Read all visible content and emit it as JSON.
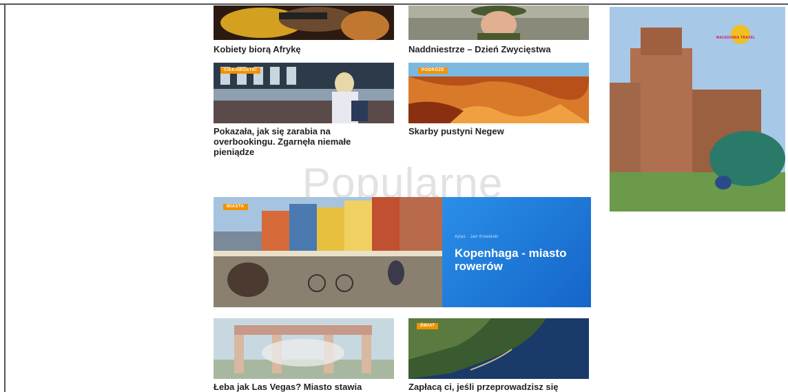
{
  "articles": [
    {
      "title": "Kobiety biorą Afrykę",
      "tag": ""
    },
    {
      "title": "Naddniestrze – Dzień Zwycięstwa",
      "tag": ""
    },
    {
      "title": "Pokazała, jak się zarabia na overbookingu. Zgarnęła niemałe pieniądze",
      "tag": "CIEKAWOSTKI"
    },
    {
      "title": "Skarby pustyni Negew",
      "tag": "PODRÓŻE"
    },
    {
      "title": "Łeba jak Las Vegas? Miasto stawia",
      "tag": ""
    },
    {
      "title": "Zapłacą ci, jeśli przeprowadzisz się",
      "tag": "ŚWIAT"
    }
  ],
  "section": {
    "heading": "Popularne"
  },
  "featured": {
    "tag": "MIASTA",
    "meta": "Ajtaś · Jan Kowalski",
    "title": "Kopenhaga - miasto rowerów"
  },
  "ad": {
    "logo_text": "MACEDONIA TRAVEL"
  },
  "colors": {
    "tag": "#f39200",
    "feature_panel": "#1e7ad8"
  }
}
